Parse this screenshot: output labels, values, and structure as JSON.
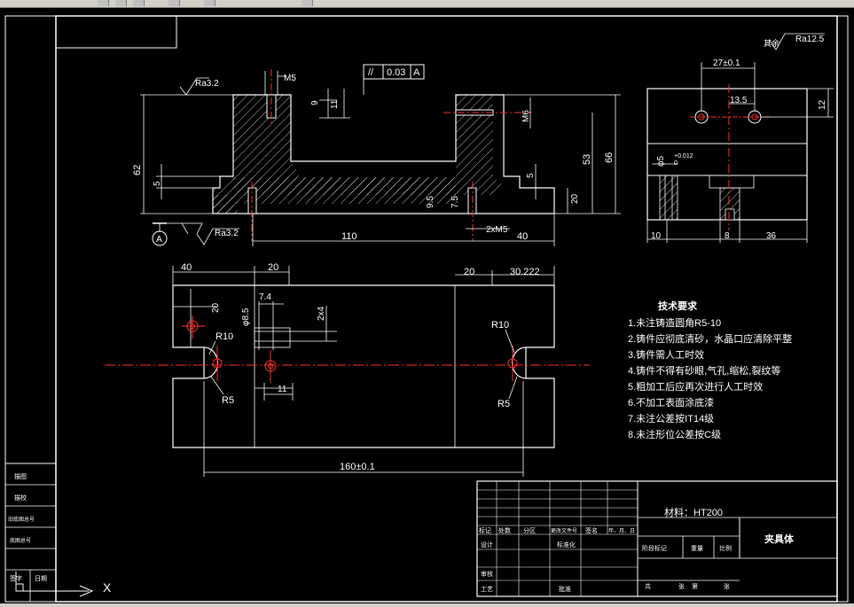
{
  "window": {
    "cursor_label": "X"
  },
  "views": {
    "front_view": {
      "roughness_top_left": "Ra3.2",
      "roughness_bottom_left": "Ra3.2",
      "datum_label": "A",
      "thread_top": "M5",
      "dim_9": "9",
      "dim_11": "11",
      "tolerance_symbol": "//",
      "tolerance_value": "0.03",
      "tolerance_datum": "A",
      "thread_right": "M6",
      "dim_62": "62",
      "dim_5_left": "5",
      "dim_53": "53",
      "dim_66": "66",
      "dim_5_right": "5",
      "dim_20": "20",
      "dim_95": "9.5",
      "dim_75": "7.5",
      "dim_110": "110",
      "dim_2xm5": "2xM5",
      "dim_40": "40"
    },
    "side_view": {
      "roughness_other": "其余",
      "roughness_value": "Ra12.5",
      "dim_27": "27±0.1",
      "dim_135": "13.5",
      "dim_12": "12",
      "dim_phi5": "φ5",
      "dim_phi5_tol": "+0.012",
      "dim_phi5_tol2": "0",
      "dim_10": "10",
      "dim_8": "8",
      "dim_36": "36"
    },
    "top_view": {
      "dim_40": "40",
      "dim_20a": "20",
      "dim_20b": "20",
      "dim_30": "30.222",
      "dim_20v": "20",
      "dim_74": "7.4",
      "dim_phi85": "φ8.5",
      "dim_2x4": "2x4",
      "dim_r10_left": "R10",
      "dim_r5_left": "R5",
      "dim_11": "11",
      "dim_r10_right": "R10",
      "dim_r5_right": "R5",
      "dim_160": "160±0.1"
    }
  },
  "tech_requirements": {
    "title": "技术要求",
    "items": [
      "1.未注铸造圆角R5-10",
      "2.铸件应彻底清砂，水晶口应清除平整",
      "3.铸件需人工时效",
      "4.铸件不得有砂眼,气孔,缩松,裂纹等",
      "5.粗加工后应再次进行人工时效",
      "6.不加工表面涂底漆",
      "7.未注公差按IT14级",
      "8.未注形位公差按C级"
    ]
  },
  "title_block": {
    "material": "材料：HT200",
    "part_name": "夹具体",
    "header_row": [
      "标记",
      "处数",
      "分区",
      "更改文件号",
      "签名",
      "年、月、日"
    ],
    "design_row": [
      "设计",
      "标准化"
    ],
    "stage": "阶段标记",
    "weight": "重量",
    "scale": "比例",
    "review": "审核",
    "craft": "工艺",
    "approve": "批准",
    "sheets": [
      "共",
      "张",
      "第",
      "张"
    ]
  },
  "left_table": [
    "描图",
    "描校",
    "旧底图总号",
    "底图总号",
    "签字",
    "日期"
  ]
}
